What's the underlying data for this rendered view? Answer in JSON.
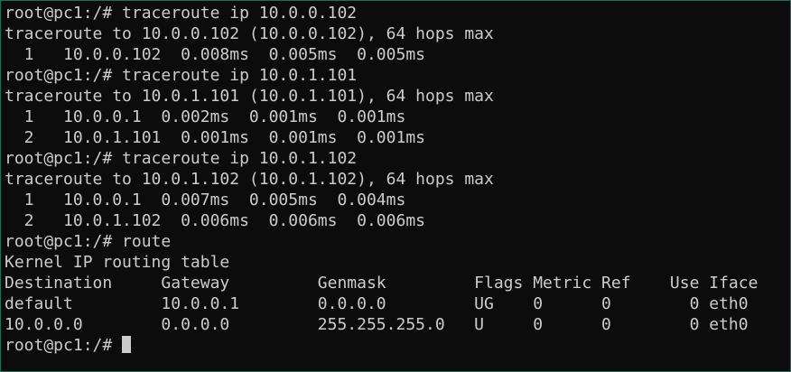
{
  "terminal": {
    "lines": [
      "root@pc1:/# traceroute ip 10.0.0.102",
      "traceroute to 10.0.0.102 (10.0.0.102), 64 hops max",
      "  1   10.0.0.102  0.008ms  0.005ms  0.005ms",
      "root@pc1:/# traceroute ip 10.0.1.101",
      "traceroute to 10.0.1.101 (10.0.1.101), 64 hops max",
      "  1   10.0.0.1  0.002ms  0.001ms  0.001ms",
      "  2   10.0.1.101  0.001ms  0.001ms  0.001ms",
      "root@pc1:/# traceroute ip 10.0.1.102",
      "traceroute to 10.0.1.102 (10.0.1.102), 64 hops max",
      "  1   10.0.0.1  0.007ms  0.005ms  0.004ms",
      "  2   10.0.1.102  0.006ms  0.006ms  0.006ms",
      "root@pc1:/# route",
      "Kernel IP routing table",
      "Destination     Gateway         Genmask         Flags Metric Ref    Use Iface",
      "default         10.0.0.1        0.0.0.0         UG    0      0        0 eth0",
      "10.0.0.0        0.0.0.0         255.255.255.0   U     0      0        0 eth0"
    ],
    "prompt": "root@pc1:/# ",
    "colors": {
      "background": "#0c0c0c",
      "text": "#cccccc",
      "border": "#1f6f5a"
    }
  }
}
